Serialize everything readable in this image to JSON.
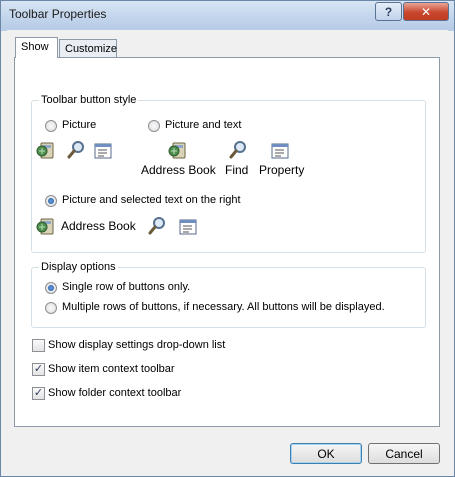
{
  "window": {
    "title": "Toolbar Properties",
    "help_label": "?",
    "close_label": "✕"
  },
  "tabs": [
    {
      "label": "Show",
      "active": true
    },
    {
      "label": "Customize",
      "active": false
    }
  ],
  "toolbar_style": {
    "title": "Toolbar button style",
    "options": [
      {
        "label": "Picture",
        "selected": false
      },
      {
        "label": "Picture and text",
        "selected": false
      },
      {
        "label": "Picture and selected text on the right",
        "selected": true
      }
    ],
    "preview_labels": {
      "address_book": "Address Book",
      "find": "Find",
      "property": "Property"
    }
  },
  "display_options": {
    "title": "Display options",
    "options": [
      {
        "label": "Single row of buttons only.",
        "selected": true
      },
      {
        "label": "Multiple rows of buttons, if necessary.  All buttons will be displayed.",
        "selected": false
      }
    ]
  },
  "checkboxes": [
    {
      "label": "Show display settings drop-down list",
      "checked": false
    },
    {
      "label": "Show item context toolbar",
      "checked": true
    },
    {
      "label": "Show folder context toolbar",
      "checked": true
    }
  ],
  "check_mark": "✓",
  "buttons": {
    "ok": "OK",
    "cancel": "Cancel"
  }
}
